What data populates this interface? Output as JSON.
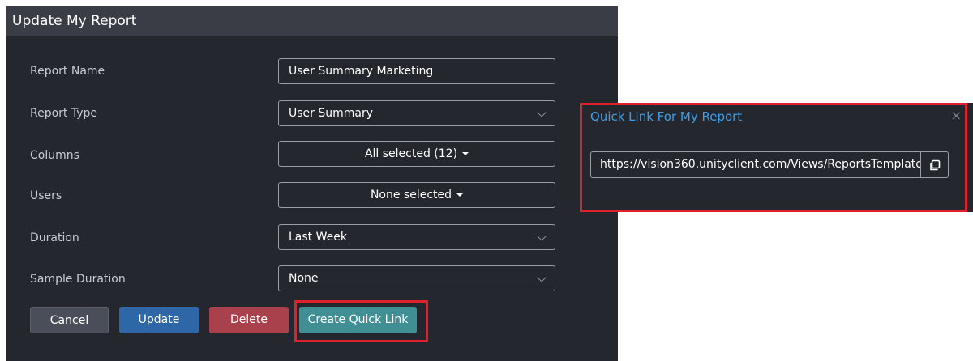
{
  "dialog": {
    "title": "Update My Report",
    "fields": [
      {
        "label": "Report Name",
        "value": "User Summary Marketing"
      },
      {
        "label": "Report Type",
        "value": "User Summary"
      },
      {
        "label": "Columns",
        "value": "All selected (12)"
      },
      {
        "label": "Users",
        "value": "None selected"
      },
      {
        "label": "Duration",
        "value": "Last Week"
      },
      {
        "label": "Sample Duration",
        "value": "None"
      }
    ],
    "buttons": {
      "cancel": "Cancel",
      "update": "Update",
      "delete": "Delete",
      "quick_link": "Create Quick Link"
    }
  },
  "popup": {
    "title": "Quick Link For My Report",
    "close": "×",
    "link": "https://vision360.unityclient.com/Views/ReportsTemplate"
  },
  "colors": {
    "dialog_bg": "#25272e",
    "header_bg": "#3a3d45",
    "cancel": "#4a4e58",
    "update": "#2e67a8",
    "delete": "#a9414d",
    "quick_link": "#3f8f94",
    "highlight": "#e0202a",
    "link_title": "#3d9ee8"
  },
  "icons": {
    "copy": "copy-icon",
    "close": "close-icon",
    "dropdown": "chevron-down-icon"
  }
}
